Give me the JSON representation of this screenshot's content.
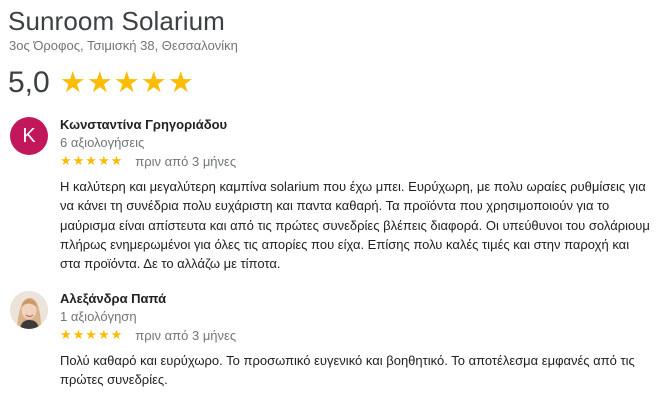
{
  "place": {
    "name": "Sunroom Solarium",
    "address": "3ος Όροφος, Τσιμισκή 38, Θεσσαλονίκη",
    "rating": "5,0",
    "stars": "★★★★★"
  },
  "colors": {
    "star": "#fbbc04",
    "avatar_letter_bg": "#c2185b"
  },
  "reviews": [
    {
      "avatar": "K",
      "author": "Κωνσταντίνα Γρηγοριάδου",
      "count": "6 αξιολογήσεις",
      "stars": "★★★★★",
      "date": "πριν από 3 μήνες",
      "text": "Η καλύτερη και μεγαλύτερη καμπίνα solarium που έχω μπει. Ευρύχωρη, με πολυ ωραίες ρυθμίσεις για να κάνει τη συνέδρια πολυ ευχάριστη και παντα καθαρή. Τα προϊόντα που χρησιμοποιούν για το μαύρισμα είναι απίστευτα και από τις πρώτες συνεδρίες βλέπεις διαφορά. Οι υπεύθυνοι του σολάριουμ πλήρως ενημερωμένοι για όλες τις απορίες που είχα. Επίσης πολυ καλές τιμές και στην παροχή και στα προϊόντα. Δε το αλλάζω με τίποτα."
    },
    {
      "avatar_icon": "user-photo-icon",
      "author": "Αλεξάνδρα Παπά",
      "count": "1 αξιολόγηση",
      "stars": "★★★★★",
      "date": "πριν από 3 μήνες",
      "text": "Πολύ καθαρό και ευρύχωρο. Το προσωπικό ευγενικό και βοηθητικό. Το αποτέλεσμα εμφανές από τις πρώτες συνεδρίες."
    }
  ]
}
